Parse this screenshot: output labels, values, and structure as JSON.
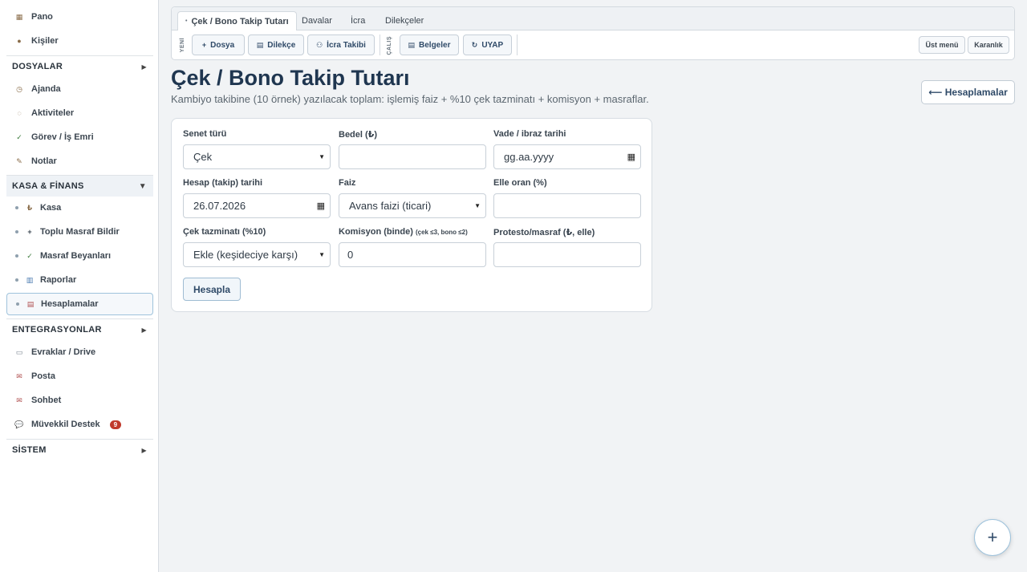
{
  "sidebar": {
    "items": [
      {
        "label": "Pano",
        "icon": "dashboard-icon"
      },
      {
        "label": "Kişiler",
        "icon": "contacts-icon"
      },
      {
        "label": "Ajanda",
        "icon": "clock-icon"
      },
      {
        "label": "Aktiviteler",
        "icon": "activity-icon"
      },
      {
        "label": "Görev / İş Emri",
        "icon": "check-icon"
      },
      {
        "label": "Notlar",
        "icon": "pencil-icon"
      }
    ],
    "sections": {
      "dosyalar": "DOSYALAR",
      "kasa": "KASA & FİNANS",
      "entegrasyonlar": "ENTEGRASYONLAR",
      "sistem": "SİSTEM"
    },
    "finance_items": [
      {
        "label": "Kasa",
        "icon": "lira-icon"
      },
      {
        "label": "Toplu Masraf Bildir",
        "icon": "plus-icon"
      },
      {
        "label": "Masraf Beyanları",
        "icon": "check-icon"
      },
      {
        "label": "Raporlar",
        "icon": "chart-icon"
      },
      {
        "label": "Hesaplamalar",
        "icon": "calculator-icon"
      }
    ],
    "integration_items": [
      {
        "label": "Evraklar / Drive",
        "icon": "folder-icon"
      },
      {
        "label": "Posta",
        "icon": "mail-icon"
      },
      {
        "label": "Sohbet",
        "icon": "mail-icon"
      },
      {
        "label": "Müvekkil Destek",
        "icon": "chat-icon",
        "badge": "9"
      }
    ]
  },
  "topbar": {
    "tabs": {
      "active": "Çek / Bono Takip Tutarı",
      "davalar": "Davalar",
      "icra": "İcra",
      "dilekceler": "Dilekçeler"
    },
    "label_yeni": "YENİ",
    "label_calis": "ÇALIŞ",
    "buttons": {
      "dosya": "Dosya",
      "dilekce": "Dilekçe",
      "icra_takibi": "İcra Takibi",
      "belgeler": "Belgeler",
      "uyap": "UYAP",
      "ust_menu": "Üst menü",
      "karanlik": "Karanlık"
    }
  },
  "page": {
    "title": "Çek / Bono Takip Tutarı",
    "subtitle": "Kambiyo takibine (10 örnek) yazılacak toplam: işlemiş faiz + %10 çek tazminatı + komisyon + masraflar.",
    "back_button": "⟵ Hesaplamalar"
  },
  "form": {
    "senet_turu": {
      "label": "Senet türü",
      "value": "Çek"
    },
    "bedel": {
      "label": "Bedel (₺)",
      "value": ""
    },
    "vade": {
      "label": "Vade / ibraz tarihi",
      "placeholder": "gg.aa.yyyy"
    },
    "hesap_tarihi": {
      "label": "Hesap (takip) tarihi",
      "value": "26.07.2026"
    },
    "faiz": {
      "label": "Faiz",
      "value": "Avans faizi (ticari)"
    },
    "elle_oran": {
      "label": "Elle oran (%)",
      "value": ""
    },
    "cek_tazminati": {
      "label": "Çek tazminatı (%10)",
      "value": "Ekle (keşideciye karşı)"
    },
    "komisyon": {
      "label": "Komisyon (binde)",
      "hint": "(çek ≤3, bono ≤2)",
      "value": "0"
    },
    "protesto": {
      "label": "Protesto/masraf (₺, elle)",
      "value": ""
    },
    "submit": "Hesapla"
  },
  "fab_symbol": "+"
}
